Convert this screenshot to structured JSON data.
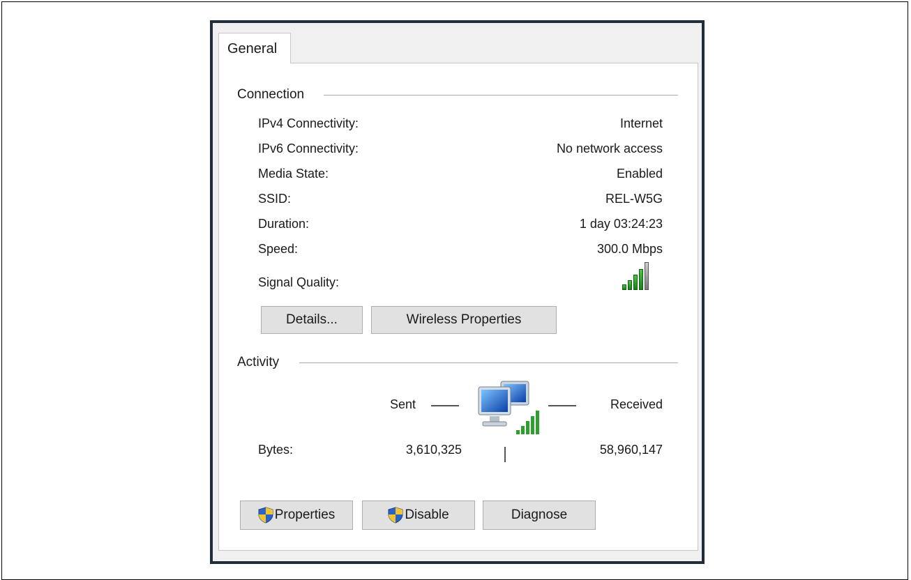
{
  "tab": {
    "general": "General"
  },
  "connection": {
    "title": "Connection",
    "rows": [
      {
        "label": "IPv4 Connectivity:",
        "value": "Internet"
      },
      {
        "label": "IPv6 Connectivity:",
        "value": "No network access"
      },
      {
        "label": "Media State:",
        "value": "Enabled"
      },
      {
        "label": "SSID:",
        "value": "REL-W5G"
      },
      {
        "label": "Duration:",
        "value": "1 day 03:24:23"
      },
      {
        "label": "Speed:",
        "value": "300.0 Mbps"
      }
    ],
    "signal_label": "Signal Quality:",
    "signal_bars_lit": 4,
    "signal_bars_total": 5,
    "details_button": "Details...",
    "wireless_button": "Wireless Properties"
  },
  "activity": {
    "title": "Activity",
    "sent_label": "Sent",
    "received_label": "Received",
    "bytes_label": "Bytes:",
    "bytes_sent": "3,610,325",
    "bytes_received": "58,960,147"
  },
  "buttons": {
    "properties": "Properties",
    "disable": "Disable",
    "diagnose": "Diagnose"
  },
  "icons": {
    "network": "network-computers-icon",
    "shield": "uac-shield-icon"
  },
  "colors": {
    "frame": "#1f2d3d",
    "signal_green": "#2e9e2e"
  }
}
